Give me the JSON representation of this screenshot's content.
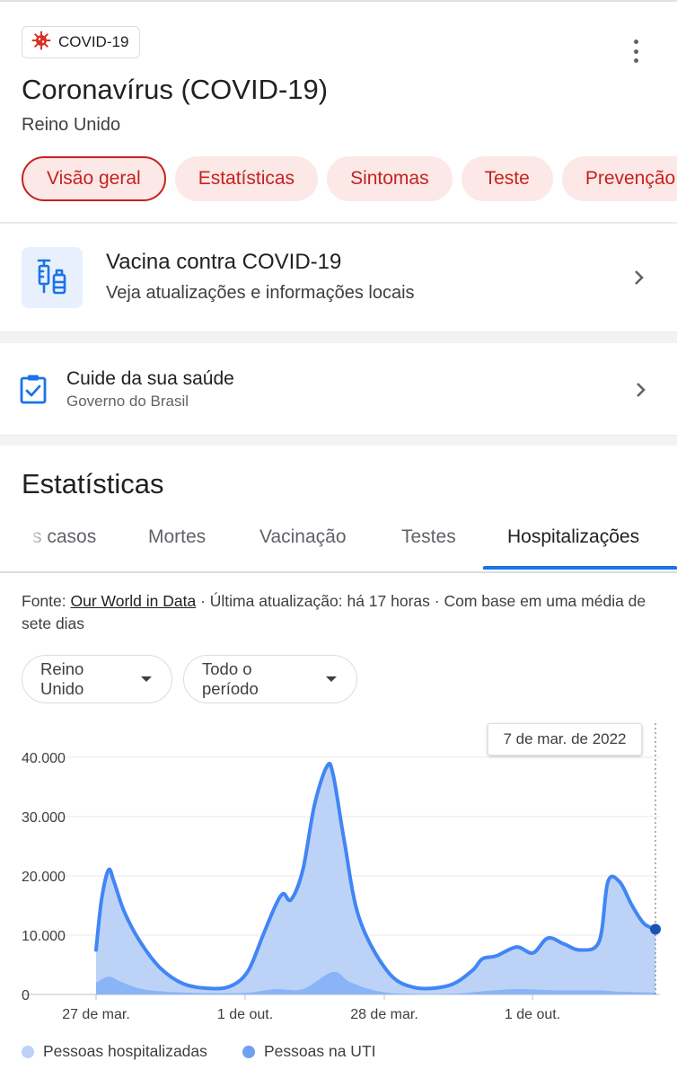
{
  "header": {
    "badge_label": "COVID-19",
    "title": "Coronavírus (COVID-19)",
    "location": "Reino Unido",
    "more_icon": "more-vert-icon"
  },
  "topic_tabs": [
    "Visão geral",
    "Estatísticas",
    "Sintomas",
    "Teste",
    "Prevenção"
  ],
  "vaccine_card": {
    "title": "Vacina contra COVID-19",
    "subtitle": "Veja atualizações e informações locais",
    "icon": "vaccine-icon"
  },
  "care_card": {
    "title": "Cuide da sua saúde",
    "subtitle": "Governo do Brasil",
    "icon": "clipboard-check-icon"
  },
  "statistics": {
    "heading": "Estatísticas",
    "tabs": [
      "Novos casos",
      "Mortes",
      "Vacinação",
      "Testes",
      "Hospitalizações"
    ],
    "tab_visible_partial": "s casos",
    "active_tab": "Hospitalizações",
    "source_prefix": "Fonte: ",
    "source_link": "Our World in Data",
    "source_suffix": " · Última atualização: há 17 horas · Com base em uma média de sete dias",
    "region_dropdown": "Reino Unido",
    "period_dropdown": "Todo o período",
    "tooltip_date": "7 de mar. de 2022"
  },
  "colors": {
    "accent_red": "#c5221f",
    "pill_bg": "#fce8e6",
    "tab_blue": "#1a73e8",
    "hospitalized_fill": "#bcd3f7",
    "icu_fill": "#8ab4f8",
    "line": "#4285f4"
  },
  "chart_data": {
    "type": "area",
    "x_tick_labels": [
      "27 de mar.",
      "1 de out.",
      "28 de mar.",
      "1 de out."
    ],
    "y_tick_labels": [
      "0",
      "10.000",
      "20.000",
      "30.000",
      "40.000"
    ],
    "ylim": [
      0,
      45000
    ],
    "grid": true,
    "legend_position": "bottom",
    "series": [
      {
        "name": "Pessoas hospitalizadas",
        "x": [
          "2020-03-20",
          "2020-03-27",
          "2020-04-05",
          "2020-04-12",
          "2020-04-25",
          "2020-05-15",
          "2020-06-10",
          "2020-07-10",
          "2020-08-15",
          "2020-09-10",
          "2020-10-01",
          "2020-10-20",
          "2020-11-05",
          "2020-11-15",
          "2020-11-25",
          "2020-12-10",
          "2020-12-25",
          "2021-01-10",
          "2021-01-18",
          "2021-02-01",
          "2021-02-20",
          "2021-03-28",
          "2021-05-01",
          "2021-06-15",
          "2021-07-15",
          "2021-07-28",
          "2021-08-15",
          "2021-09-10",
          "2021-10-01",
          "2021-10-20",
          "2021-11-10",
          "2021-12-01",
          "2021-12-25",
          "2022-01-05",
          "2022-01-20",
          "2022-02-05",
          "2022-02-20",
          "2022-03-07"
        ],
        "values": [
          7500,
          16000,
          21000,
          19000,
          14000,
          9000,
          4500,
          1800,
          1000,
          1500,
          4000,
          10000,
          15000,
          17000,
          16000,
          21000,
          32000,
          38500,
          37000,
          26000,
          13000,
          4000,
          1200,
          1500,
          4000,
          6000,
          6500,
          8000,
          7000,
          9500,
          8500,
          7500,
          9000,
          19000,
          19000,
          15000,
          12000,
          11000
        ]
      },
      {
        "name": "Pessoas na UTI",
        "x": [
          "2020-03-20",
          "2020-04-05",
          "2020-04-20",
          "2020-05-15",
          "2020-06-15",
          "2020-08-15",
          "2020-10-01",
          "2020-11-05",
          "2020-12-10",
          "2021-01-18",
          "2021-02-10",
          "2021-03-28",
          "2021-06-15",
          "2021-07-25",
          "2021-09-10",
          "2021-11-01",
          "2021-12-25",
          "2022-01-15",
          "2022-03-07"
        ],
        "values": [
          2000,
          3000,
          2200,
          1000,
          500,
          200,
          300,
          900,
          900,
          3800,
          2000,
          300,
          100,
          500,
          900,
          700,
          700,
          500,
          300
        ]
      }
    ]
  }
}
